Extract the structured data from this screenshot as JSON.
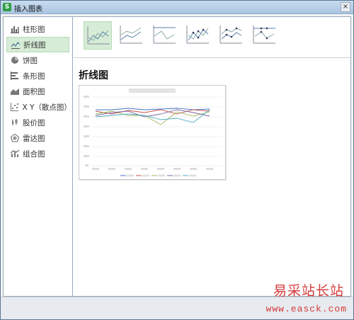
{
  "window": {
    "title": "插入图表",
    "app_icon": "S",
    "close_glyph": "×"
  },
  "sidebar": {
    "items": [
      {
        "label": "柱形图",
        "icon": "bar-chart-icon"
      },
      {
        "label": "折线图",
        "icon": "line-chart-icon",
        "selected": true
      },
      {
        "label": "饼图",
        "icon": "pie-chart-icon"
      },
      {
        "label": "条形图",
        "icon": "horizontal-bar-chart-icon"
      },
      {
        "label": "面积图",
        "icon": "area-chart-icon"
      },
      {
        "label": "X Y（散点图）",
        "icon": "scatter-chart-icon"
      },
      {
        "label": "股价图",
        "icon": "stock-chart-icon"
      },
      {
        "label": "雷达图",
        "icon": "radar-chart-icon"
      },
      {
        "label": "组合图",
        "icon": "combo-chart-icon"
      }
    ]
  },
  "gallery": {
    "selected_index": 0,
    "variants": [
      "line",
      "stacked-line",
      "percent-stacked-line",
      "line-with-markers",
      "stacked-line-with-markers",
      "percent-stacked-line-with-markers"
    ]
  },
  "main": {
    "section_title": "折线图"
  },
  "preview": {
    "colors": {
      "series": [
        "#4472c4",
        "#c0504d",
        "#9bbb59",
        "#8064a2",
        "#4bacc6"
      ],
      "accent_selected": "#d6ecd6"
    }
  },
  "watermark": {
    "line1": "易采站长站",
    "line2": "www.easck.com",
    "color": "#d43a3a"
  }
}
